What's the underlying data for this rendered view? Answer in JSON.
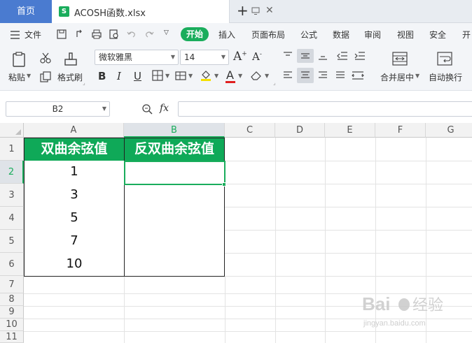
{
  "tabs": {
    "home_label": "首页",
    "file_badge": "S",
    "file_name": "ACOSH函数.xlsx",
    "add_label": "+"
  },
  "menu": {
    "file_label": "文件",
    "items": [
      "开始",
      "插入",
      "页面布局",
      "公式",
      "数据",
      "审阅",
      "视图",
      "安全",
      "开"
    ]
  },
  "ribbon": {
    "paste_label": "粘贴",
    "format_painter_label": "格式刷",
    "font_name": "微软雅黑",
    "font_size": "14",
    "merge_label": "合并居中",
    "wrap_label": "自动换行",
    "bold": "B",
    "italic": "I",
    "underline": "U"
  },
  "formula_bar": {
    "cell_ref": "B2",
    "fx_label": "fx",
    "value": ""
  },
  "sheet": {
    "columns": [
      "A",
      "B",
      "C",
      "D",
      "E",
      "F",
      "G"
    ],
    "rows": [
      "1",
      "2",
      "3",
      "4",
      "5",
      "6",
      "7",
      "8",
      "9",
      "10",
      "11"
    ],
    "header_a": "双曲余弦值",
    "header_b": "反双曲余弦值",
    "values_a": [
      "1",
      "3",
      "5",
      "7",
      "10"
    ],
    "values_b": [
      "",
      "",
      "",
      "",
      ""
    ],
    "active_cell": "B2"
  },
  "watermark": {
    "brand": "Bai",
    "brand2": "经验",
    "url": "jingyan.baidu.com"
  },
  "colors": {
    "accent": "#1aad5c",
    "header_fill": "#0fa958",
    "tab_active": "#4a7bd0"
  }
}
